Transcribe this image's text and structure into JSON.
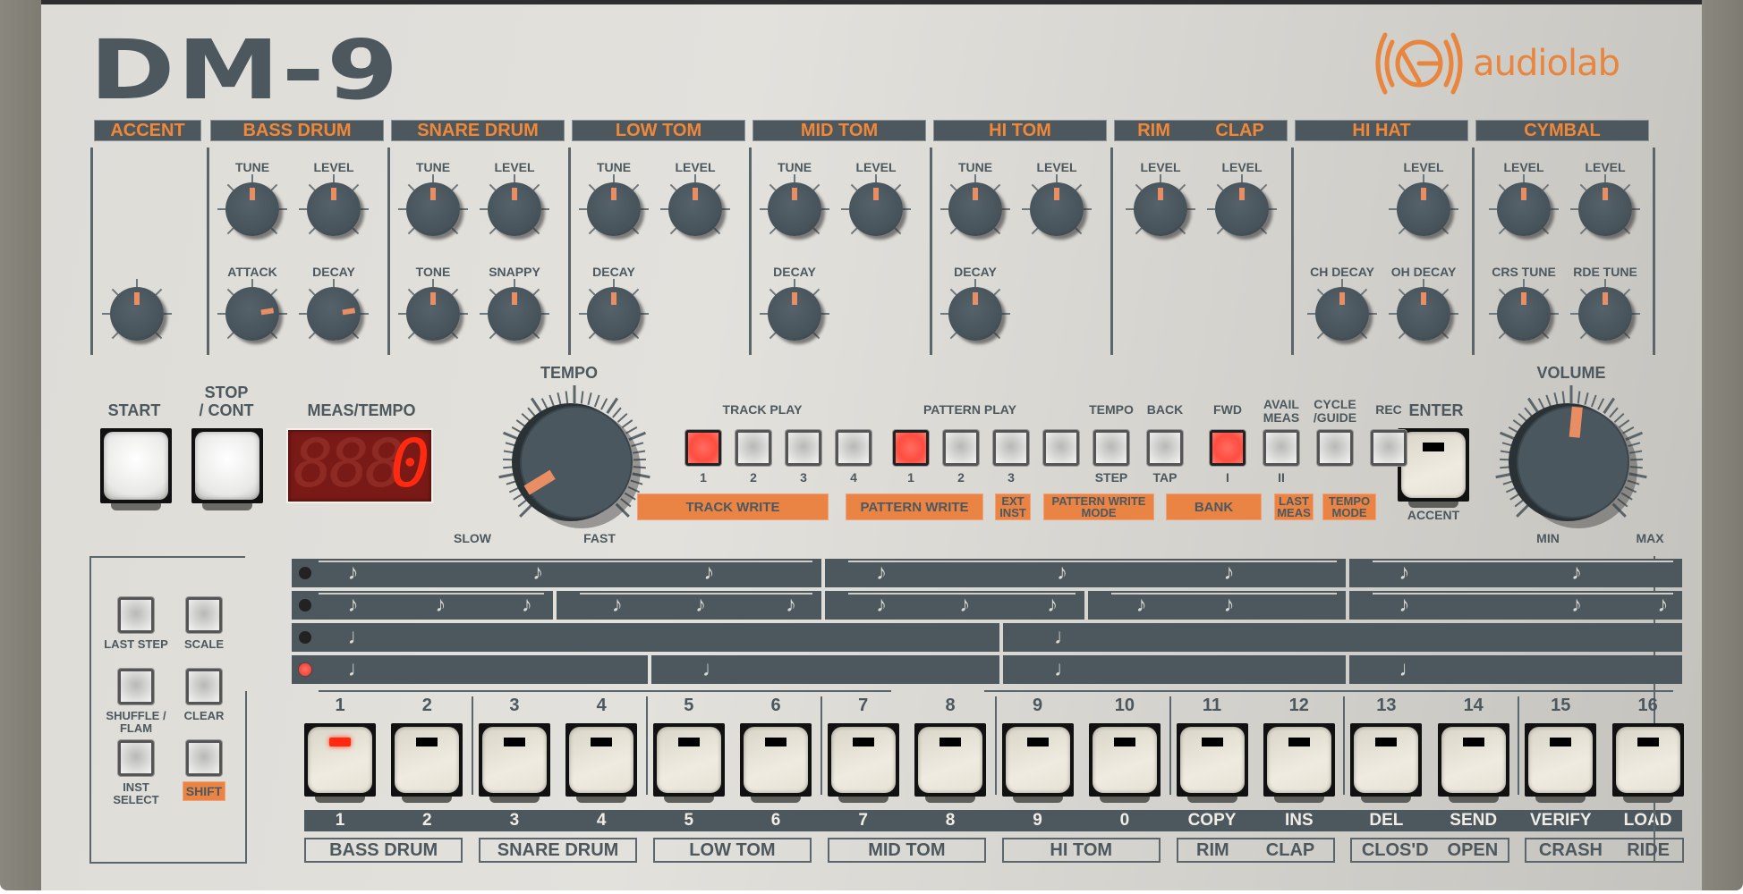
{
  "brand": {
    "model": "DM-9",
    "maker": "audiolab",
    "accent_color": "#e8853e",
    "panel_dark": "#4c585e"
  },
  "instruments": [
    {
      "name": "ACCENT",
      "knobs": [
        {
          "label": "",
          "value": 0.5
        }
      ]
    },
    {
      "name": "BASS DRUM",
      "knobs": [
        {
          "label": "TUNE",
          "value": 0.5
        },
        {
          "label": "LEVEL",
          "value": 0.5
        },
        {
          "label": "ATTACK",
          "value": 0.8
        },
        {
          "label": "DECAY",
          "value": 0.8
        }
      ]
    },
    {
      "name": "SNARE DRUM",
      "knobs": [
        {
          "label": "TUNE",
          "value": 0.5
        },
        {
          "label": "LEVEL",
          "value": 0.5
        },
        {
          "label": "TONE",
          "value": 0.5
        },
        {
          "label": "SNAPPY",
          "value": 0.5
        }
      ]
    },
    {
      "name": "LOW TOM",
      "knobs": [
        {
          "label": "TUNE",
          "value": 0.5
        },
        {
          "label": "LEVEL",
          "value": 0.5
        },
        {
          "label": "DECAY",
          "value": 0.5
        }
      ]
    },
    {
      "name": "MID TOM",
      "knobs": [
        {
          "label": "TUNE",
          "value": 0.5
        },
        {
          "label": "LEVEL",
          "value": 0.5
        },
        {
          "label": "DECAY",
          "value": 0.5
        }
      ]
    },
    {
      "name": "HI TOM",
      "knobs": [
        {
          "label": "TUNE",
          "value": 0.5
        },
        {
          "label": "LEVEL",
          "value": 0.5
        },
        {
          "label": "DECAY",
          "value": 0.5
        }
      ]
    },
    {
      "name_left": "RIM",
      "name_right": "CLAP",
      "knobs": [
        {
          "label": "LEVEL",
          "value": 0.5
        },
        {
          "label": "LEVEL",
          "value": 0.5
        }
      ]
    },
    {
      "name": "HI HAT",
      "knobs": [
        {
          "label": "LEVEL",
          "value": 0.5
        },
        {
          "label": "CH DECAY",
          "value": 0.5
        },
        {
          "label": "OH DECAY",
          "value": 0.5
        }
      ]
    },
    {
      "name": "CYMBAL",
      "knobs": [
        {
          "label": "LEVEL",
          "value": 0.5
        },
        {
          "label": "LEVEL",
          "value": 0.5
        },
        {
          "label": "CRS TUNE",
          "value": 0.5
        },
        {
          "label": "RDE TUNE",
          "value": 0.5
        }
      ]
    }
  ],
  "transport": {
    "start": "START",
    "stop_line1": "STOP",
    "stop_line2": "/ CONT",
    "display_label": "MEAS/TEMPO",
    "display_value": "0",
    "tempo_label": "TEMPO",
    "tempo_min": "SLOW",
    "tempo_max": "FAST",
    "tempo_value": 0.05
  },
  "track_play": {
    "label": "TRACK PLAY",
    "buttons": [
      {
        "num": "1",
        "on": true
      },
      {
        "num": "2",
        "on": false
      },
      {
        "num": "3",
        "on": false
      },
      {
        "num": "4",
        "on": false
      }
    ],
    "write_label": "TRACK WRITE"
  },
  "pattern_play": {
    "label": "PATTERN PLAY",
    "buttons": [
      {
        "num": "1",
        "on": true
      },
      {
        "num": "2",
        "on": false
      },
      {
        "num": "3",
        "on": false
      },
      {
        "num": "",
        "on": false
      }
    ],
    "write_label": "PATTERN WRITE",
    "ext_inst": "EXT INST"
  },
  "mode_buttons": [
    {
      "top": "TEMPO",
      "bottom": "STEP",
      "on": false
    },
    {
      "top": "BACK",
      "bottom": "TAP",
      "on": false
    },
    {
      "top": "FWD",
      "bottom": "I",
      "on": true
    },
    {
      "top": "AVAIL MEAS",
      "bottom": "II",
      "on": false
    },
    {
      "top": "CYCLE /GUIDE",
      "bottom": "",
      "on": false
    },
    {
      "top": "REC",
      "bottom": "",
      "on": false
    }
  ],
  "mode_labels": {
    "pattern_write_mode": "PATTERN WRITE MODE",
    "bank": "BANK",
    "last_meas": "LAST MEAS",
    "tempo_mode": "TEMPO MODE"
  },
  "enter": {
    "label": "ENTER",
    "sub": "ACCENT"
  },
  "volume": {
    "label": "VOLUME",
    "min": "MIN",
    "max": "MAX",
    "value": 0.52
  },
  "function_buttons": [
    {
      "label": "LAST STEP"
    },
    {
      "label": "SCALE"
    },
    {
      "label": "SHUFFLE / FLAM"
    },
    {
      "label": "CLEAR"
    },
    {
      "label": "INST SELECT"
    },
    {
      "label": "SHIFT"
    }
  ],
  "scale_rows": [
    {
      "active": false,
      "note": "eighth-triplet"
    },
    {
      "active": false,
      "note": "sixteenth-triplet"
    },
    {
      "active": false,
      "note": "quarter"
    },
    {
      "active": true,
      "note": "quarter-half"
    }
  ],
  "steps": [
    {
      "num": "1",
      "alt": "1",
      "led": true
    },
    {
      "num": "2",
      "alt": "2",
      "led": false
    },
    {
      "num": "3",
      "alt": "3",
      "led": false
    },
    {
      "num": "4",
      "alt": "4",
      "led": false
    },
    {
      "num": "5",
      "alt": "5",
      "led": false
    },
    {
      "num": "6",
      "alt": "6",
      "led": false
    },
    {
      "num": "7",
      "alt": "7",
      "led": false
    },
    {
      "num": "8",
      "alt": "8",
      "led": false
    },
    {
      "num": "9",
      "alt": "9",
      "led": false
    },
    {
      "num": "10",
      "alt": "0",
      "led": false
    },
    {
      "num": "11",
      "alt": "COPY",
      "led": false
    },
    {
      "num": "12",
      "alt": "INS",
      "led": false
    },
    {
      "num": "13",
      "alt": "DEL",
      "led": false
    },
    {
      "num": "14",
      "alt": "SEND",
      "led": false
    },
    {
      "num": "15",
      "alt": "VERIFY",
      "led": false
    },
    {
      "num": "16",
      "alt": "LOAD",
      "led": false
    }
  ],
  "inst_groups": [
    {
      "labels": [
        "BASS DRUM"
      ]
    },
    {
      "labels": [
        "SNARE DRUM"
      ]
    },
    {
      "labels": [
        "LOW TOM"
      ]
    },
    {
      "labels": [
        "MID TOM"
      ]
    },
    {
      "labels": [
        "HI TOM"
      ]
    },
    {
      "labels": [
        "RIM",
        "CLAP"
      ]
    },
    {
      "labels": [
        "CLOS'D",
        "OPEN"
      ]
    },
    {
      "labels": [
        "CRASH",
        "RIDE"
      ]
    }
  ]
}
